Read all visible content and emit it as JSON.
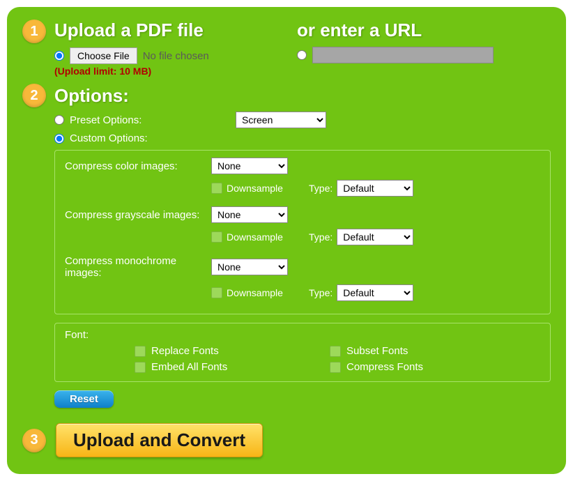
{
  "step1": {
    "num": "1",
    "title_left": "Upload a PDF file",
    "title_right": "or enter a URL",
    "choose_btn": "Choose File",
    "no_file": "No file chosen",
    "limit": "(Upload limit: 10 MB)"
  },
  "step2": {
    "num": "2",
    "title": "Options:",
    "preset_label": "Preset Options:",
    "preset_value": "Screen",
    "custom_label": "Custom Options:",
    "compress": {
      "color_label": "Compress color images:",
      "gray_label": "Compress grayscale images:",
      "mono_label": "Compress monochrome images:",
      "none": "None",
      "downsample": "Downsample",
      "type_label": "Type:",
      "default": "Default"
    },
    "font": {
      "header": "Font:",
      "replace": "Replace Fonts",
      "subset": "Subset Fonts",
      "embed": "Embed All Fonts",
      "compress": "Compress Fonts"
    },
    "reset": "Reset"
  },
  "step3": {
    "num": "3",
    "button": "Upload and Convert"
  }
}
